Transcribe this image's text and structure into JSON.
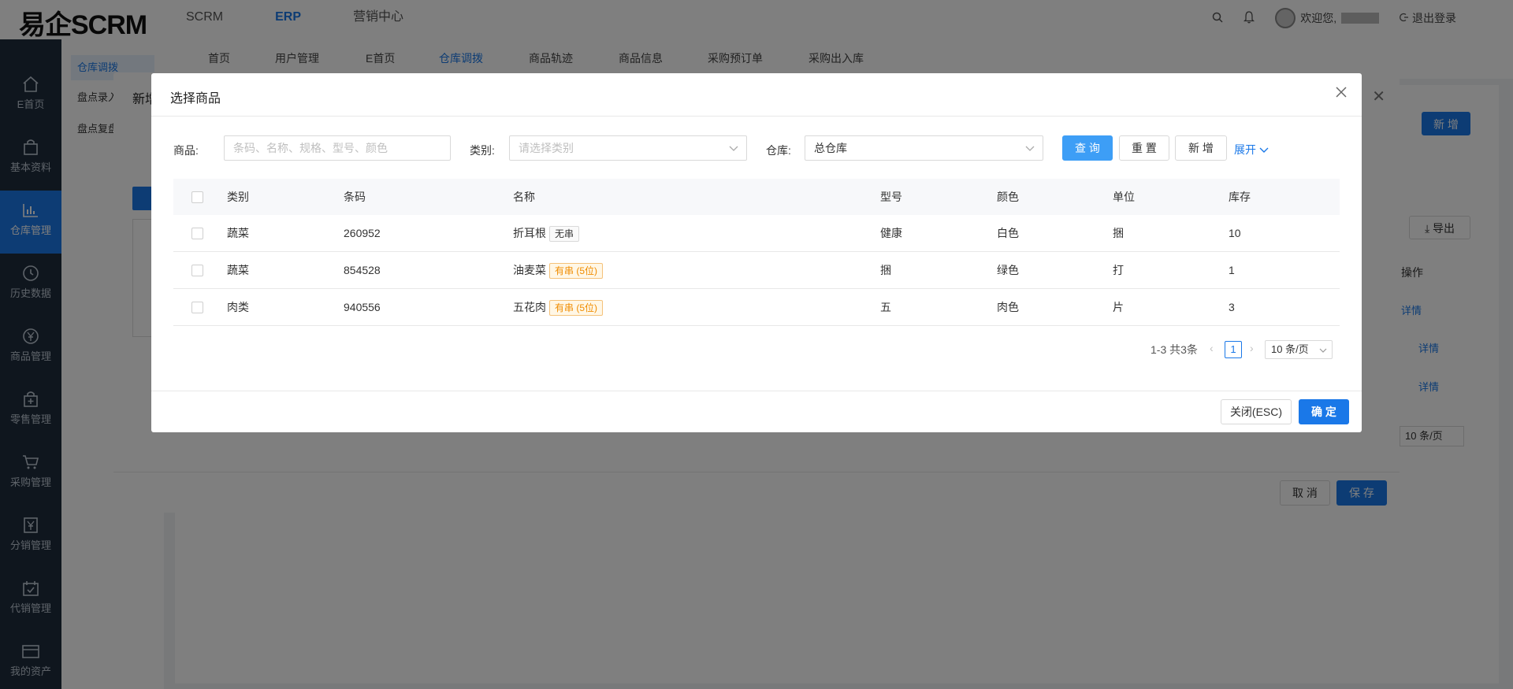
{
  "app": {
    "logo": "易企SCRM",
    "topnav": [
      "SCRM",
      "ERP",
      "营销中心"
    ],
    "active_topnav": "ERP",
    "welcome": "欢迎您,",
    "logout": "退出登录"
  },
  "sidebar": {
    "items": [
      {
        "label": "E首页",
        "icon": "home-icon"
      },
      {
        "label": "基本资料",
        "icon": "bag-icon"
      },
      {
        "label": "仓库管理",
        "icon": "chart-icon"
      },
      {
        "label": "历史数据",
        "icon": "clock-icon"
      },
      {
        "label": "商品管理",
        "icon": "yen-icon"
      },
      {
        "label": "零售管理",
        "icon": "plus-bag-icon"
      },
      {
        "label": "采购管理",
        "icon": "cart-icon"
      },
      {
        "label": "分销管理",
        "icon": "yen-box-icon"
      },
      {
        "label": "代销管理",
        "icon": "calendar-icon"
      },
      {
        "label": "我的资产",
        "icon": "wallet-icon"
      }
    ],
    "active": "仓库管理"
  },
  "subsidebar": {
    "items": [
      "仓库调拨",
      "盘点录入",
      "盘点复盘"
    ],
    "active": "仓库调拨"
  },
  "tabs": {
    "items": [
      "首页",
      "用户管理",
      "E首页",
      "仓库调拨",
      "商品轨迹",
      "商品信息",
      "采购预订单",
      "采购出入库"
    ],
    "active": "仓库调拨"
  },
  "background": {
    "new_button": "新 增",
    "export_button": "导出",
    "ops_header": "操作",
    "detail_link": "详情",
    "page_size": "10 条/页"
  },
  "add_dialog": {
    "title": "新增",
    "cancel": "取 消",
    "save": "保 存"
  },
  "select_dialog": {
    "title": "选择商品",
    "filters": {
      "product_label": "商品:",
      "product_placeholder": "条码、名称、规格、型号、颜色",
      "category_label": "类别:",
      "category_placeholder": "请选择类别",
      "warehouse_label": "仓库:",
      "warehouse_value": "总仓库"
    },
    "buttons": {
      "query": "查 询",
      "reset": "重 置",
      "add": "新 增",
      "expand": "展开"
    },
    "columns": [
      "类别",
      "条码",
      "名称",
      "型号",
      "颜色",
      "单位",
      "库存"
    ],
    "rows": [
      {
        "category": "蔬菜",
        "barcode": "260952",
        "name": "折耳根",
        "tag": "无串",
        "tag_type": "none",
        "model": "健康",
        "color": "白色",
        "unit": "捆",
        "stock": "10"
      },
      {
        "category": "蔬菜",
        "barcode": "854528",
        "name": "油麦菜",
        "tag": "有串 (5位)",
        "tag_type": "has",
        "model": "捆",
        "color": "绿色",
        "unit": "打",
        "stock": "1"
      },
      {
        "category": "肉类",
        "barcode": "940556",
        "name": "五花肉",
        "tag": "有串 (5位)",
        "tag_type": "has",
        "model": "五",
        "color": "肉色",
        "unit": "片",
        "stock": "3"
      }
    ],
    "pagination": {
      "total_text": "1-3 共3条",
      "current_page": "1",
      "page_size": "10 条/页"
    },
    "footer": {
      "close": "关闭(ESC)",
      "confirm": "确 定"
    }
  },
  "colors": {
    "primary": "#1a78e8",
    "sidebar_bg": "#1f2d3d",
    "tag_orange": "#f08c00"
  }
}
